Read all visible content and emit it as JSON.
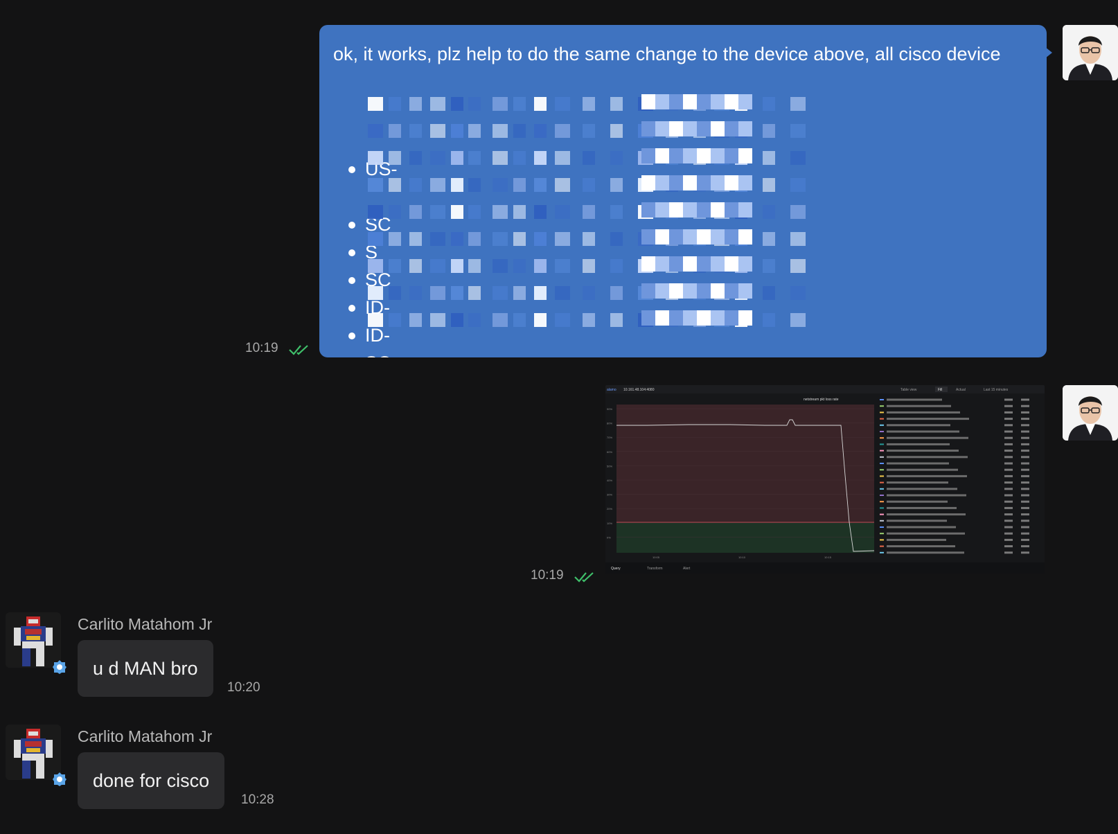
{
  "messages": {
    "out1": {
      "text": "ok, it works, plz help to do the same change to the device above, all cisco device",
      "bullets": [
        "",
        "US-",
        "",
        "SC",
        "S",
        "SC",
        "ID-",
        "ID-",
        "SC"
      ],
      "time": "10:19"
    },
    "out2": {
      "time": "10:19",
      "screenshot": {
        "toolbar_left": "alamo",
        "toolbar_host": "10.161.48.104:4080",
        "toolbar_table_view": "Table view",
        "toolbar_fill": "Fill",
        "toolbar_actual": "Actual",
        "toolbar_range": "Last 15 minutes",
        "panel_title": "netstream pkt loss rate",
        "tabs": [
          "Query",
          "Transform",
          "Alert"
        ],
        "y_ticks": [
          "90%",
          "80%",
          "70%",
          "60%",
          "50%",
          "40%",
          "30%",
          "20%",
          "10%",
          "0%"
        ],
        "x_ticks": [
          "10:05",
          "10:10",
          "10:15"
        ]
      }
    },
    "in1": {
      "sender": "Carlito Matahom Jr",
      "text": "u d MAN bro",
      "time": "10:20"
    },
    "in2": {
      "sender": "Carlito Matahom Jr",
      "text": "done for cisco",
      "time": "10:28"
    }
  },
  "colors": {
    "background": "#131314",
    "outgoing_bubble": "#3f73c0",
    "incoming_bubble": "#2b2b2d",
    "read_check": "#3fbf6a"
  }
}
